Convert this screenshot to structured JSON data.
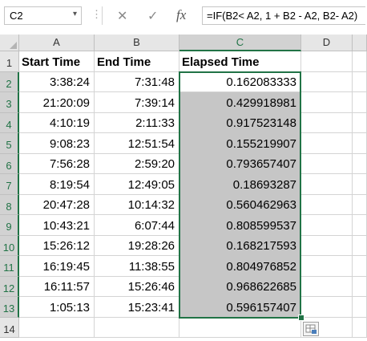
{
  "formula_bar": {
    "name_box": "C2",
    "formula": "=IF(B2< A2, 1 + B2 - A2, B2- A2)",
    "cancel_glyph": "✕",
    "enter_glyph": "✓",
    "fx_glyph": "fx",
    "dropdown_glyph": "▾",
    "dots": "⋮"
  },
  "columns": [
    "A",
    "B",
    "C",
    "D"
  ],
  "rows": [
    "1",
    "2",
    "3",
    "4",
    "5",
    "6",
    "7",
    "8",
    "9",
    "10",
    "11",
    "12",
    "13",
    "14"
  ],
  "selected_cell": "C2",
  "selected_column": "C",
  "headers": {
    "a": "Start Time",
    "b": "End Time",
    "c": "Elapsed Time"
  },
  "data": [
    {
      "start": "3:38:24",
      "end": "7:31:48",
      "elapsed": "0.162083333"
    },
    {
      "start": "21:20:09",
      "end": "7:39:14",
      "elapsed": "0.429918981"
    },
    {
      "start": "4:10:19",
      "end": "2:11:33",
      "elapsed": "0.917523148"
    },
    {
      "start": "9:08:23",
      "end": "12:51:54",
      "elapsed": "0.155219907"
    },
    {
      "start": "7:56:28",
      "end": "2:59:20",
      "elapsed": "0.793657407"
    },
    {
      "start": "8:19:54",
      "end": "12:49:05",
      "elapsed": "0.18693287"
    },
    {
      "start": "20:47:28",
      "end": "10:14:32",
      "elapsed": "0.560462963"
    },
    {
      "start": "10:43:21",
      "end": "6:07:44",
      "elapsed": "0.808599537"
    },
    {
      "start": "15:26:12",
      "end": "19:28:26",
      "elapsed": "0.168217593"
    },
    {
      "start": "16:19:45",
      "end": "11:38:55",
      "elapsed": "0.804976852"
    },
    {
      "start": "16:11:57",
      "end": "15:26:46",
      "elapsed": "0.968622685"
    },
    {
      "start": "1:05:13",
      "end": "15:23:41",
      "elapsed": "0.596157407"
    }
  ],
  "icons": {
    "name_box_dropdown": "chevron-down-icon",
    "cancel": "close-icon",
    "enter": "check-icon",
    "insert_function": "fx-icon",
    "quick_analysis": "quick-analysis-icon"
  },
  "colors": {
    "selection": "#217346",
    "range_fill": "#c6c6c6",
    "header_bg": "#e6e6e6"
  }
}
